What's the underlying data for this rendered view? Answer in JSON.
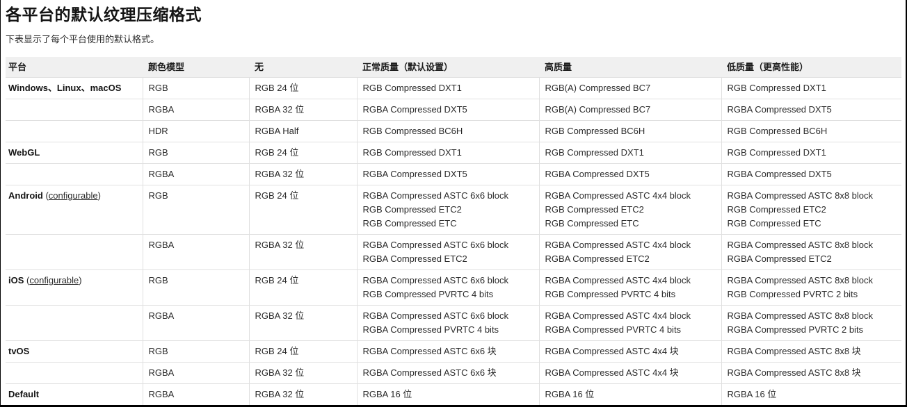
{
  "page": {
    "title": "各平台的默认纹理压缩格式",
    "intro": "下表显示了每个平台使用的默认格式。"
  },
  "chars": {
    "open": "(",
    "close": ")"
  },
  "table": {
    "headers": [
      "平台",
      "颜色模型",
      "无",
      "正常质量（默认设置）",
      "高质量",
      "低质量（更高性能）"
    ],
    "rows": [
      {
        "platform": "Windows、Linux、macOS",
        "color_model": "RGB",
        "none": "RGB 24 位",
        "normal": "RGB Compressed DXT1",
        "high": "RGB(A) Compressed BC7",
        "low": "RGB Compressed DXT1"
      },
      {
        "platform": "",
        "color_model": "RGBA",
        "none": "RGBA 32 位",
        "normal": "RGBA Compressed DXT5",
        "high": "RGB(A) Compressed BC7",
        "low": "RGBA Compressed DXT5"
      },
      {
        "platform": "",
        "color_model": "HDR",
        "none": "RGBA Half",
        "normal": "RGB Compressed BC6H",
        "high": "RGB Compressed BC6H",
        "low": "RGB Compressed BC6H"
      },
      {
        "platform": "WebGL",
        "color_model": "RGB",
        "none": "RGB 24 位",
        "normal": "RGB Compressed DXT1",
        "high": "RGB Compressed DXT1",
        "low": "RGB Compressed DXT1"
      },
      {
        "platform": "",
        "color_model": "RGBA",
        "none": "RGBA 32 位",
        "normal": "RGBA Compressed DXT5",
        "high": "RGBA Compressed DXT5",
        "low": "RGBA Compressed DXT5"
      },
      {
        "platform": "Android",
        "configurable": "configurable",
        "color_model": "RGB",
        "none": "RGB 24 位",
        "normal": "RGBA Compressed ASTC 6x6 block\nRGB Compressed ETC2\nRGB Compressed ETC",
        "high": "RGBA Compressed ASTC 4x4 block\nRGB Compressed ETC2\nRGB Compressed ETC",
        "low": "RGBA Compressed ASTC 8x8 block\nRGB Compressed ETC2\nRGB Compressed ETC"
      },
      {
        "platform": "",
        "color_model": "RGBA",
        "none": "RGBA 32 位",
        "normal": "RGBA Compressed ASTC 6x6 block\nRGBA Compressed ETC2",
        "high": "RGBA Compressed ASTC 4x4 block\nRGBA Compressed ETC2",
        "low": "RGBA Compressed ASTC 8x8 block\nRGBA Compressed ETC2"
      },
      {
        "platform": "iOS",
        "configurable": "configurable",
        "color_model": "RGB",
        "none": "RGB 24 位",
        "normal": "RGBA Compressed ASTC 6x6 block\nRGB Compressed PVRTC 4 bits",
        "high": "RGBA Compressed ASTC 4x4 block\nRGB Compressed PVRTC 4 bits",
        "low": "RGBA Compressed ASTC 8x8 block\nRGB Compressed PVRTC 2 bits"
      },
      {
        "platform": "",
        "color_model": "RGBA",
        "none": "RGBA 32 位",
        "normal": "RGBA Compressed ASTC 6x6 block\nRGBA Compressed PVRTC 4 bits",
        "high": "RGBA Compressed ASTC 4x4 block\nRGBA Compressed PVRTC 4 bits",
        "low": "RGBA Compressed ASTC 8x8 block\nRGBA Compressed PVRTC 2 bits"
      },
      {
        "platform": "tvOS",
        "color_model": "RGB",
        "none": "RGB 24 位",
        "normal": "RGBA Compressed ASTC 6x6 块",
        "high": "RGBA Compressed ASTC 4x4 块",
        "low": "RGBA Compressed ASTC 8x8 块"
      },
      {
        "platform": "",
        "color_model": "RGBA",
        "none": "RGBA 32 位",
        "normal": "RGBA Compressed ASTC 6x6 块",
        "high": "RGBA Compressed ASTC 4x4 块",
        "low": "RGBA Compressed ASTC 8x8 块"
      },
      {
        "platform": "Default",
        "color_model": "RGBA",
        "none": "RGBA 32 位",
        "normal": "RGBA 16 位",
        "high": "RGBA 16 位",
        "low": "RGBA 16 位"
      }
    ]
  }
}
